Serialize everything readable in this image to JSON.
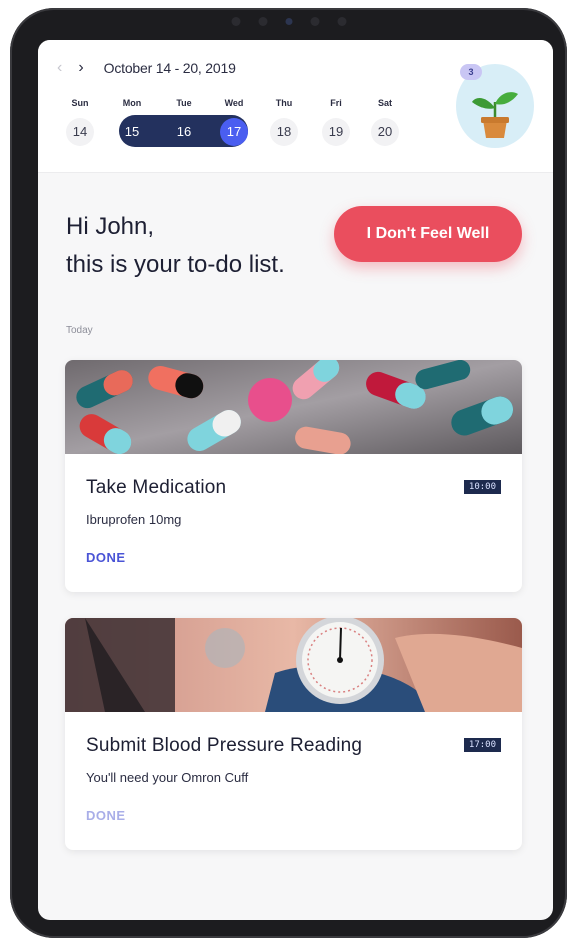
{
  "header": {
    "date_range": "October 14 - 20, 2019",
    "week": [
      {
        "day": "Sun",
        "date": "14"
      },
      {
        "day": "Mon",
        "date": "15"
      },
      {
        "day": "Tue",
        "date": "16"
      },
      {
        "day": "Wed",
        "date": "17"
      },
      {
        "day": "Thu",
        "date": "18"
      },
      {
        "day": "Fri",
        "date": "19"
      },
      {
        "day": "Sat",
        "date": "20"
      }
    ],
    "notification_count": "3"
  },
  "greeting": {
    "line1": "Hi John,",
    "line2": "this is your to-do list."
  },
  "cta_label": "I Don't Feel Well",
  "section_label": "Today",
  "tasks": [
    {
      "title": "Take Medication",
      "subtitle": "Ibruprofen 10mg",
      "time": "10:00",
      "action": "DONE"
    },
    {
      "title": "Submit Blood Pressure Reading",
      "subtitle": "You'll need your Omron Cuff",
      "time": "17:00",
      "action": "DONE"
    }
  ],
  "colors": {
    "accent": "#ea4e5e",
    "primary": "#4a5ef0",
    "dark": "#23315e"
  }
}
